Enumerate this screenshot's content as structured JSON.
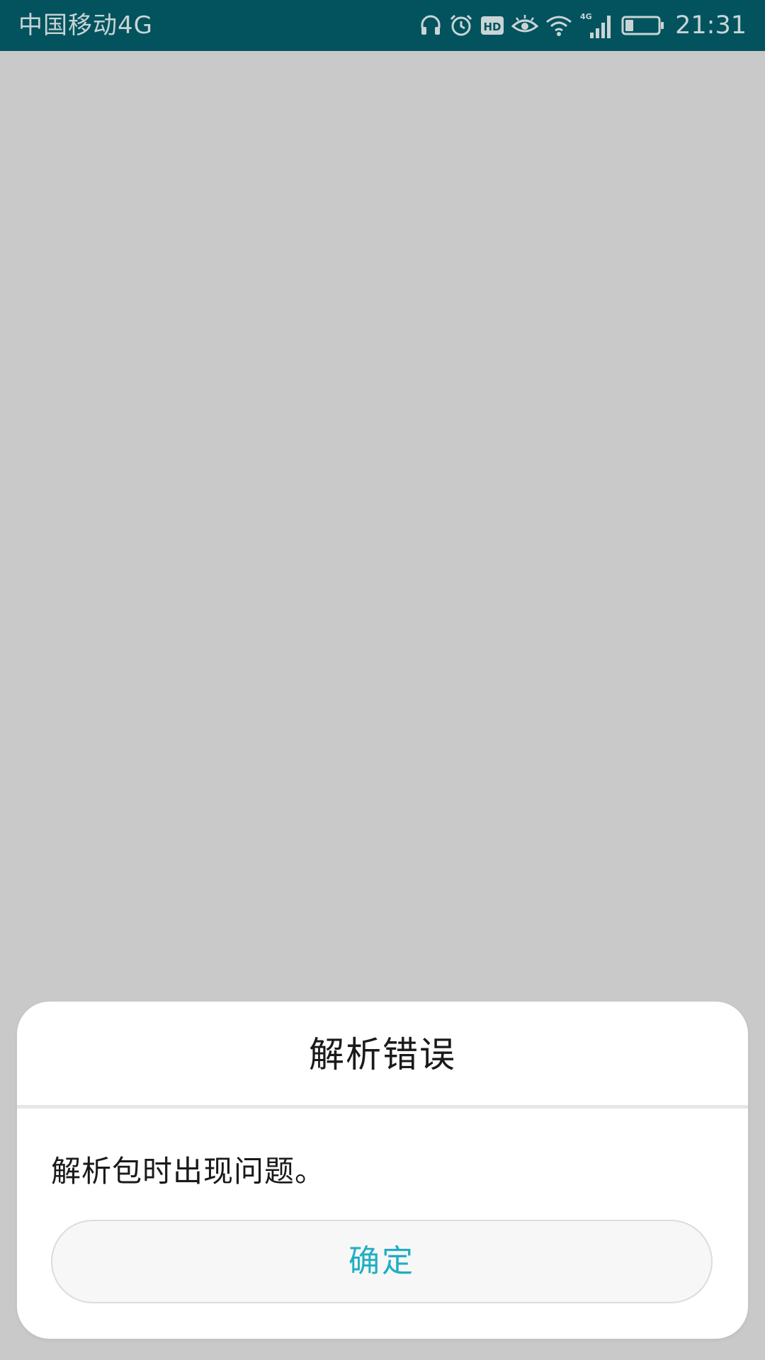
{
  "status_bar": {
    "carrier": "中国移动4G",
    "network_badge": "4G",
    "time": "21:31",
    "icons": [
      "headset-icon",
      "alarm-icon",
      "hd-icon",
      "eye-comfort-icon",
      "wifi-icon",
      "signal-4g-icon",
      "battery-icon"
    ],
    "hd_label": "HD",
    "battery_level": 0.25
  },
  "dialog": {
    "title": "解析错误",
    "message": "解析包时出现问题。",
    "ok_label": "确定"
  },
  "colors": {
    "status_bar_bg": "#02535e",
    "background": "#c9c9c9",
    "accent": "#1faec2"
  }
}
